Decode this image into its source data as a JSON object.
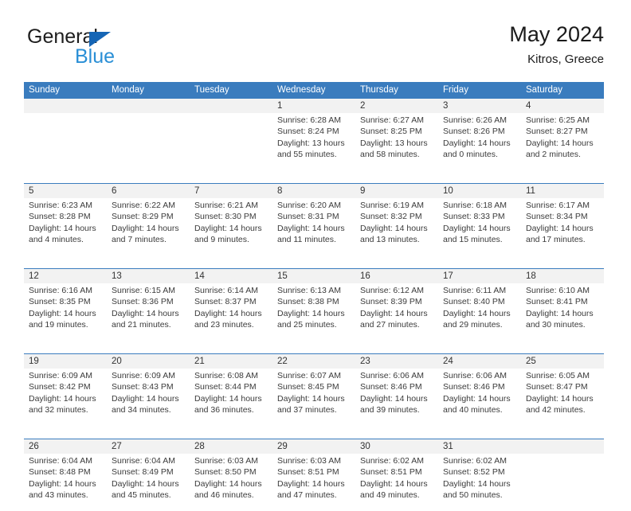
{
  "brand": {
    "name_part1": "General",
    "name_part2": "Blue",
    "logo_icon": "triangle-play-icon"
  },
  "header": {
    "title": "May 2024",
    "subtitle": "Kitros, Greece"
  },
  "colors": {
    "header_band": "#3a7cbe",
    "daynum_band": "#f2f2f2",
    "brand_dark": "#1d1d1d",
    "brand_blue": "#2a8fd6",
    "logo_blue": "#1565b5",
    "text": "#3b3b3b"
  },
  "weekday_headers": [
    "Sunday",
    "Monday",
    "Tuesday",
    "Wednesday",
    "Thursday",
    "Friday",
    "Saturday"
  ],
  "labels": {
    "sunrise": "Sunrise:",
    "sunset": "Sunset:",
    "daylight": "Daylight:"
  },
  "weeks": [
    {
      "days": [
        {
          "num": "",
          "l1": "",
          "l2": "",
          "l3": "",
          "l4": ""
        },
        {
          "num": "",
          "l1": "",
          "l2": "",
          "l3": "",
          "l4": ""
        },
        {
          "num": "",
          "l1": "",
          "l2": "",
          "l3": "",
          "l4": ""
        },
        {
          "num": "1",
          "l1": "Sunrise: 6:28 AM",
          "l2": "Sunset: 8:24 PM",
          "l3": "Daylight: 13 hours",
          "l4": "and 55 minutes."
        },
        {
          "num": "2",
          "l1": "Sunrise: 6:27 AM",
          "l2": "Sunset: 8:25 PM",
          "l3": "Daylight: 13 hours",
          "l4": "and 58 minutes."
        },
        {
          "num": "3",
          "l1": "Sunrise: 6:26 AM",
          "l2": "Sunset: 8:26 PM",
          "l3": "Daylight: 14 hours",
          "l4": "and 0 minutes."
        },
        {
          "num": "4",
          "l1": "Sunrise: 6:25 AM",
          "l2": "Sunset: 8:27 PM",
          "l3": "Daylight: 14 hours",
          "l4": "and 2 minutes."
        }
      ]
    },
    {
      "days": [
        {
          "num": "5",
          "l1": "Sunrise: 6:23 AM",
          "l2": "Sunset: 8:28 PM",
          "l3": "Daylight: 14 hours",
          "l4": "and 4 minutes."
        },
        {
          "num": "6",
          "l1": "Sunrise: 6:22 AM",
          "l2": "Sunset: 8:29 PM",
          "l3": "Daylight: 14 hours",
          "l4": "and 7 minutes."
        },
        {
          "num": "7",
          "l1": "Sunrise: 6:21 AM",
          "l2": "Sunset: 8:30 PM",
          "l3": "Daylight: 14 hours",
          "l4": "and 9 minutes."
        },
        {
          "num": "8",
          "l1": "Sunrise: 6:20 AM",
          "l2": "Sunset: 8:31 PM",
          "l3": "Daylight: 14 hours",
          "l4": "and 11 minutes."
        },
        {
          "num": "9",
          "l1": "Sunrise: 6:19 AM",
          "l2": "Sunset: 8:32 PM",
          "l3": "Daylight: 14 hours",
          "l4": "and 13 minutes."
        },
        {
          "num": "10",
          "l1": "Sunrise: 6:18 AM",
          "l2": "Sunset: 8:33 PM",
          "l3": "Daylight: 14 hours",
          "l4": "and 15 minutes."
        },
        {
          "num": "11",
          "l1": "Sunrise: 6:17 AM",
          "l2": "Sunset: 8:34 PM",
          "l3": "Daylight: 14 hours",
          "l4": "and 17 minutes."
        }
      ]
    },
    {
      "days": [
        {
          "num": "12",
          "l1": "Sunrise: 6:16 AM",
          "l2": "Sunset: 8:35 PM",
          "l3": "Daylight: 14 hours",
          "l4": "and 19 minutes."
        },
        {
          "num": "13",
          "l1": "Sunrise: 6:15 AM",
          "l2": "Sunset: 8:36 PM",
          "l3": "Daylight: 14 hours",
          "l4": "and 21 minutes."
        },
        {
          "num": "14",
          "l1": "Sunrise: 6:14 AM",
          "l2": "Sunset: 8:37 PM",
          "l3": "Daylight: 14 hours",
          "l4": "and 23 minutes."
        },
        {
          "num": "15",
          "l1": "Sunrise: 6:13 AM",
          "l2": "Sunset: 8:38 PM",
          "l3": "Daylight: 14 hours",
          "l4": "and 25 minutes."
        },
        {
          "num": "16",
          "l1": "Sunrise: 6:12 AM",
          "l2": "Sunset: 8:39 PM",
          "l3": "Daylight: 14 hours",
          "l4": "and 27 minutes."
        },
        {
          "num": "17",
          "l1": "Sunrise: 6:11 AM",
          "l2": "Sunset: 8:40 PM",
          "l3": "Daylight: 14 hours",
          "l4": "and 29 minutes."
        },
        {
          "num": "18",
          "l1": "Sunrise: 6:10 AM",
          "l2": "Sunset: 8:41 PM",
          "l3": "Daylight: 14 hours",
          "l4": "and 30 minutes."
        }
      ]
    },
    {
      "days": [
        {
          "num": "19",
          "l1": "Sunrise: 6:09 AM",
          "l2": "Sunset: 8:42 PM",
          "l3": "Daylight: 14 hours",
          "l4": "and 32 minutes."
        },
        {
          "num": "20",
          "l1": "Sunrise: 6:09 AM",
          "l2": "Sunset: 8:43 PM",
          "l3": "Daylight: 14 hours",
          "l4": "and 34 minutes."
        },
        {
          "num": "21",
          "l1": "Sunrise: 6:08 AM",
          "l2": "Sunset: 8:44 PM",
          "l3": "Daylight: 14 hours",
          "l4": "and 36 minutes."
        },
        {
          "num": "22",
          "l1": "Sunrise: 6:07 AM",
          "l2": "Sunset: 8:45 PM",
          "l3": "Daylight: 14 hours",
          "l4": "and 37 minutes."
        },
        {
          "num": "23",
          "l1": "Sunrise: 6:06 AM",
          "l2": "Sunset: 8:46 PM",
          "l3": "Daylight: 14 hours",
          "l4": "and 39 minutes."
        },
        {
          "num": "24",
          "l1": "Sunrise: 6:06 AM",
          "l2": "Sunset: 8:46 PM",
          "l3": "Daylight: 14 hours",
          "l4": "and 40 minutes."
        },
        {
          "num": "25",
          "l1": "Sunrise: 6:05 AM",
          "l2": "Sunset: 8:47 PM",
          "l3": "Daylight: 14 hours",
          "l4": "and 42 minutes."
        }
      ]
    },
    {
      "days": [
        {
          "num": "26",
          "l1": "Sunrise: 6:04 AM",
          "l2": "Sunset: 8:48 PM",
          "l3": "Daylight: 14 hours",
          "l4": "and 43 minutes."
        },
        {
          "num": "27",
          "l1": "Sunrise: 6:04 AM",
          "l2": "Sunset: 8:49 PM",
          "l3": "Daylight: 14 hours",
          "l4": "and 45 minutes."
        },
        {
          "num": "28",
          "l1": "Sunrise: 6:03 AM",
          "l2": "Sunset: 8:50 PM",
          "l3": "Daylight: 14 hours",
          "l4": "and 46 minutes."
        },
        {
          "num": "29",
          "l1": "Sunrise: 6:03 AM",
          "l2": "Sunset: 8:51 PM",
          "l3": "Daylight: 14 hours",
          "l4": "and 47 minutes."
        },
        {
          "num": "30",
          "l1": "Sunrise: 6:02 AM",
          "l2": "Sunset: 8:51 PM",
          "l3": "Daylight: 14 hours",
          "l4": "and 49 minutes."
        },
        {
          "num": "31",
          "l1": "Sunrise: 6:02 AM",
          "l2": "Sunset: 8:52 PM",
          "l3": "Daylight: 14 hours",
          "l4": "and 50 minutes."
        },
        {
          "num": "",
          "l1": "",
          "l2": "",
          "l3": "",
          "l4": ""
        }
      ]
    }
  ]
}
